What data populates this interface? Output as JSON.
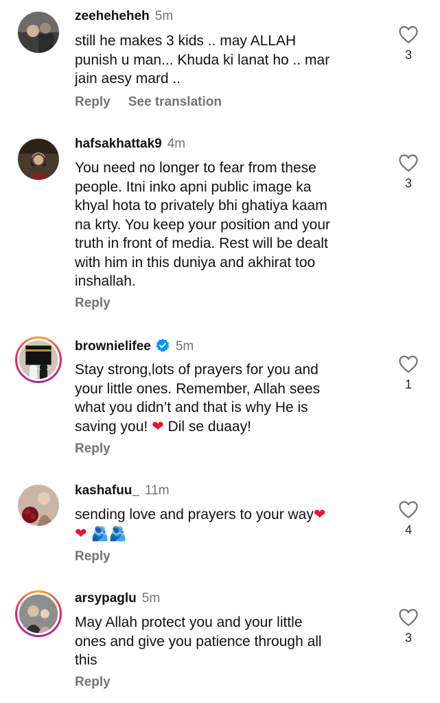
{
  "comments": [
    {
      "username": "zeeheheheh",
      "time": "5m",
      "text_lines": [
        "still he makes 3 kids .. may ALLAH",
        "punish u man... Khuda ki lanat ho .. mar",
        "jain aesy mard .."
      ],
      "likes": "3",
      "reply": "Reply",
      "translate": "See translation"
    },
    {
      "username": "hafsakhattak9",
      "time": "4m",
      "text_lines": [
        "You need no longer to fear from these",
        "people. Itni inko apni public image ka",
        "khyal hota to privately bhi ghatiya kaam",
        "na krty. You keep your position and your",
        "truth in front of media. Rest will be dealt",
        "with him in this duniya and akhirat too",
        "inshallah."
      ],
      "likes": "3",
      "reply": "Reply"
    },
    {
      "username": "brownielifee",
      "time": "5m",
      "text_lines": [
        "Stay strong,lots of prayers for you and",
        "your little ones. Remember, Allah sees",
        "what you didn’t and that is why He is",
        "saving you!"
      ],
      "text_tail": "Dil se duaay!",
      "likes": "1",
      "reply": "Reply"
    },
    {
      "username": "kashafuu_",
      "time": "11m",
      "text_lines": [
        "sending love and prayers to your way"
      ],
      "likes": "4",
      "reply": "Reply"
    },
    {
      "username": "arsypaglu",
      "time": "5m",
      "text_lines": [
        "May Allah protect you and your little",
        "ones and give you patience through all",
        "this"
      ],
      "likes": "3",
      "reply": "Reply"
    }
  ],
  "emoji": {
    "heart": "❤",
    "hug": "🫂"
  },
  "colors": {
    "secondary": "#737373",
    "text": "#111111",
    "heart": "#e8152f",
    "story_ring": "#e91e63",
    "verified": "#0095f6"
  }
}
